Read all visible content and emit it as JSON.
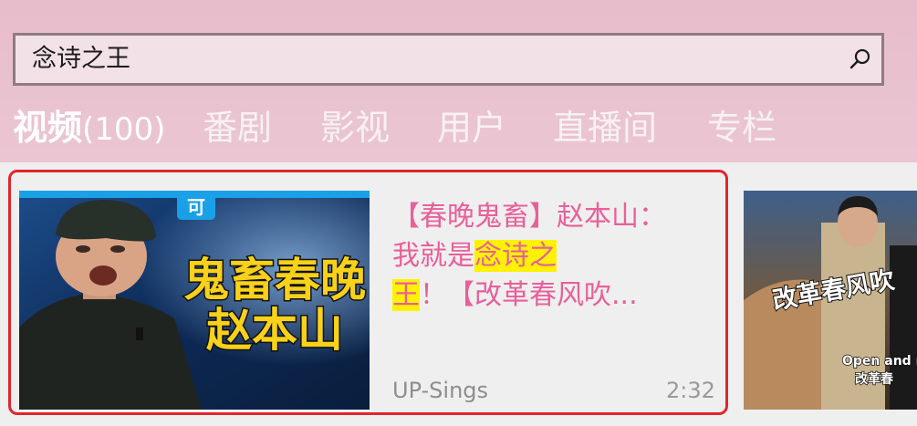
{
  "search": {
    "query": "念诗之王",
    "icon": "search-icon"
  },
  "tabs": [
    {
      "label": "视频",
      "count": "(100)",
      "active": true
    },
    {
      "label": "番剧"
    },
    {
      "label": "影视"
    },
    {
      "label": "用户"
    },
    {
      "label": "直播间"
    },
    {
      "label": "专栏"
    }
  ],
  "results": [
    {
      "title_before": "【春晚鬼畜】赵本山：我就是",
      "title_highlight_1": "念诗之",
      "title_highlight_2": "王",
      "title_after": "！【改革春风吹...",
      "uploader": "UP-Sings",
      "duration": "2:32",
      "thumbnail": {
        "badge": "可",
        "caption_line1": "鬼畜春晚",
        "caption_line2": "赵本山"
      }
    },
    {
      "thumbnail": {
        "caption": "改革春风吹",
        "subtitle_en": "Open and r",
        "subtitle_cn": "改革春"
      }
    }
  ],
  "colors": {
    "header_bg": "#e9c2cf",
    "accent_pink": "#e8609a",
    "highlight": "#fff200",
    "focus_border": "#e0262e"
  }
}
